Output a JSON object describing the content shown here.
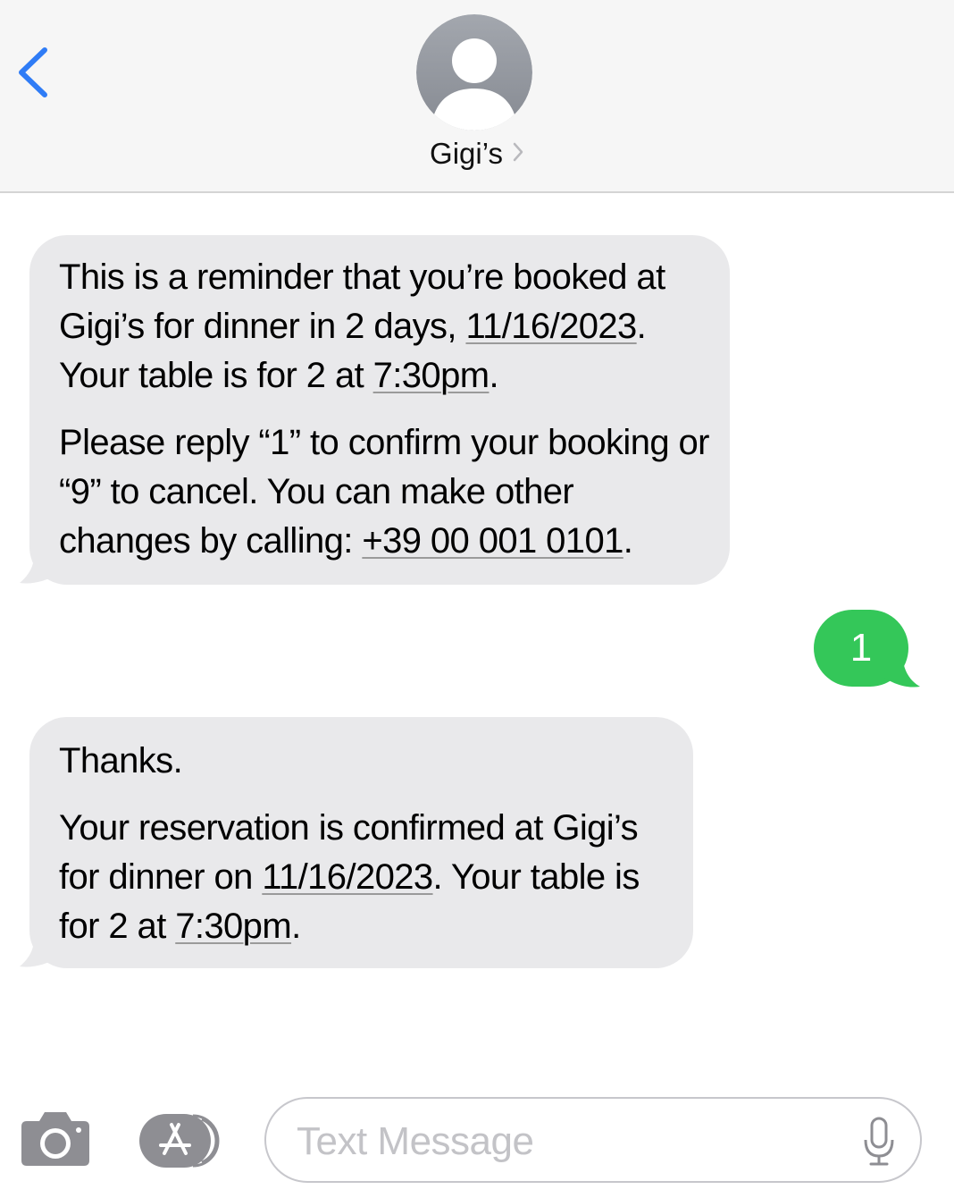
{
  "header": {
    "contact_name": "Gigi’s",
    "accent_color": "#2f7cf6"
  },
  "messages": [
    {
      "direction": "incoming",
      "p1": {
        "t1": "This is a reminder that you’re booked at Gigi’s for dinner in 2 days, ",
        "date": "11/16/2023",
        "t2": ". Your table is for 2 at ",
        "time": "7:30pm",
        "t3": "."
      },
      "p2": {
        "t1": "Please reply “1” to confirm your booking or “9” to cancel. You can make other changes by calling: ",
        "phone": "+39 00 001 0101",
        "t2": "."
      }
    },
    {
      "direction": "outgoing",
      "text": "1",
      "color": "#34c759"
    },
    {
      "direction": "incoming",
      "p1": "Thanks.",
      "p2": {
        "t1": "Your reservation is confirmed at Gigi’s for dinner on ",
        "date": "11/16/2023",
        "t2": ". Your table is for 2 at ",
        "time": "7:30pm",
        "t3": "."
      }
    }
  ],
  "composer": {
    "placeholder": "Text Message",
    "icons": [
      "camera-icon",
      "app-store-icon",
      "microphone-icon"
    ]
  }
}
